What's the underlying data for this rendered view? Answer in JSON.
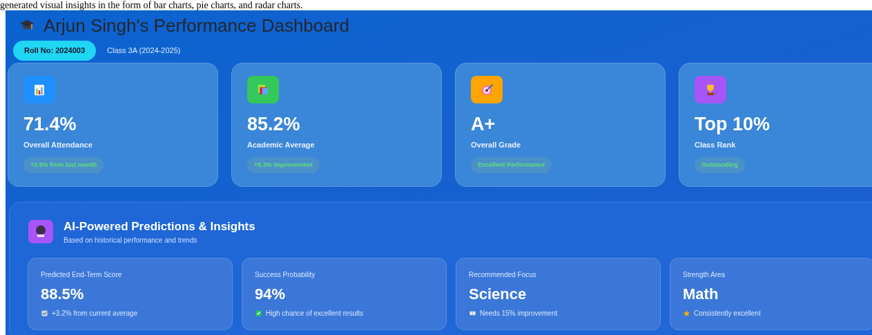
{
  "caption": "generated visual insights in the form of bar charts, pie charts, and radar charts.",
  "header": {
    "title": "Arjun Singh's Performance Dashboard",
    "roll": "Roll No: 2024003",
    "class_info": "Class 3A (2024-2025)"
  },
  "stats": [
    {
      "kind": "chart",
      "value": "71.4%",
      "label": "Overall Attendance",
      "badge": "+2.5% from last month",
      "color": "#1e90ff"
    },
    {
      "kind": "books",
      "value": "85.2%",
      "label": "Academic Average",
      "badge": "+5.3% improvement",
      "color": "#34c759"
    },
    {
      "kind": "target",
      "value": "A+",
      "label": "Overall Grade",
      "badge": "Excellent Performance",
      "color": "#ffa500"
    },
    {
      "kind": "trophy",
      "value": "Top 10%",
      "label": "Class Rank",
      "badge": "Outstanding",
      "color": "#a855f7"
    }
  ],
  "predictions": {
    "title": "AI-Powered Predictions & Insights",
    "subtitle": "Based on historical performance and trends",
    "cards": [
      {
        "kind": "trend",
        "label": "Predicted End-Term Score",
        "value": "88.5%",
        "note": "+3.2% from current average"
      },
      {
        "kind": "check",
        "label": "Success Probability",
        "value": "94%",
        "note": "High chance of excellent results"
      },
      {
        "kind": "book",
        "label": "Recommended Focus",
        "value": "Science",
        "note": "Needs 15% improvement"
      },
      {
        "kind": "star",
        "label": "Strength Area",
        "value": "Math",
        "note": "Consistently excellent"
      }
    ]
  }
}
